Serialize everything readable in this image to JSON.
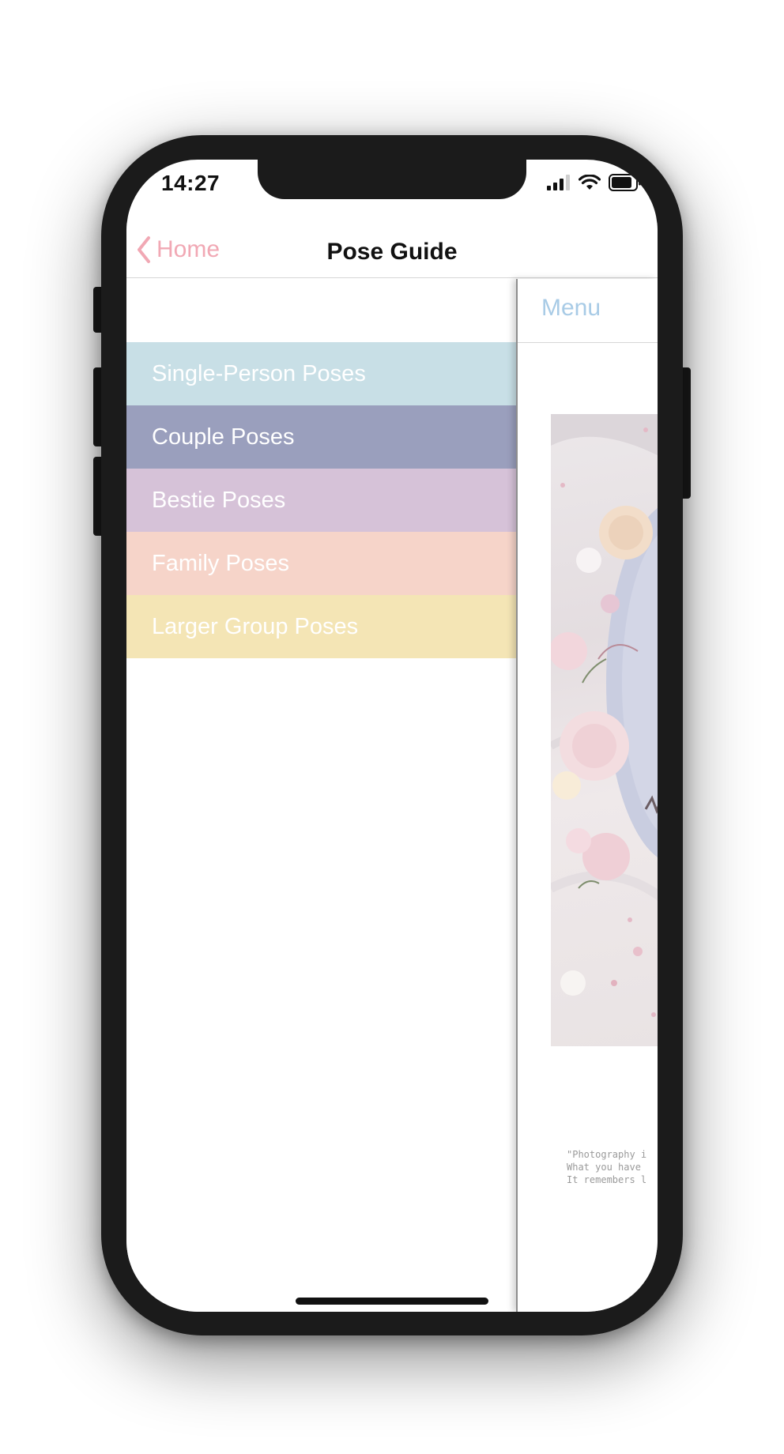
{
  "status_bar": {
    "time": "14:27",
    "signal_icon": "cellular-signal-icon",
    "wifi_icon": "wifi-icon",
    "battery_icon": "battery-icon"
  },
  "nav": {
    "back_label": "Home",
    "back_icon": "chevron-left-icon",
    "title": "Pose Guide",
    "accent_color": "#f1a8b4"
  },
  "menu": {
    "items": [
      {
        "label": "Single-Person Poses",
        "color": "#c8dfe6"
      },
      {
        "label": "Couple Poses",
        "color": "#9a9fbd"
      },
      {
        "label": "Bestie Poses",
        "color": "#d6c2d8"
      },
      {
        "label": "Family Poses",
        "color": "#f6d4c9"
      },
      {
        "label": "Larger Group Poses",
        "color": "#f4e5b5"
      }
    ]
  },
  "content": {
    "menu_label": "Menu",
    "menu_color": "#a8cbe6",
    "quote_lines": [
      "\"Photography i",
      "What you have",
      "It remembers l"
    ]
  }
}
